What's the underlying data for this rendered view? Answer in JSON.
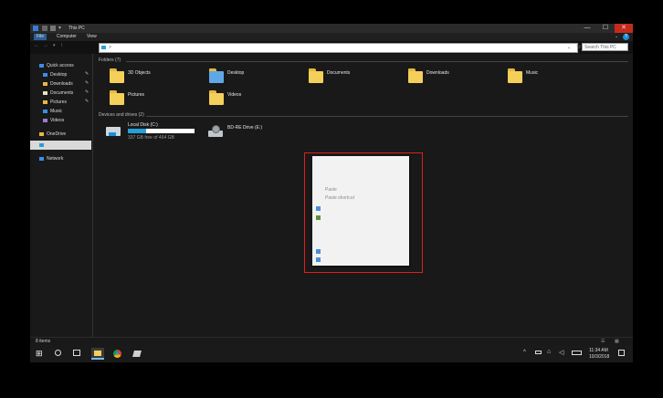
{
  "window": {
    "title": "This PC",
    "controls": {
      "minimize": "—",
      "maximize": "☐",
      "close": "✕"
    }
  },
  "ribbon": {
    "tabs": [
      "File",
      "Computer",
      "View"
    ],
    "help": "?"
  },
  "address": {
    "path_chevron": ">",
    "search_placeholder": "Search This PC"
  },
  "nav": {
    "quick_access": "Quick access",
    "items": [
      "Desktop",
      "Downloads",
      "Documents",
      "Pictures",
      "Music",
      "Videos"
    ],
    "onedrive": "OneDrive",
    "network": "Network"
  },
  "folders": {
    "header": "Folders (7)",
    "items": [
      "3D Objects",
      "Desktop",
      "Documents",
      "Downloads",
      "Music",
      "Pictures",
      "Videos"
    ]
  },
  "drives": {
    "header": "Devices and drives (2)",
    "local_disk": {
      "name": "Local Disk (C:)",
      "free_text": "337 GB free of 464 GB",
      "used_fraction": 0.27
    },
    "bd_drive": {
      "name": "BD-RE Drive (E:)"
    }
  },
  "context_menu": {
    "items": [
      "Paste",
      "Paste shortcut"
    ]
  },
  "status": {
    "count": "8 items"
  },
  "taskbar": {
    "time": "11:34 AM",
    "date": "10/3/2018"
  },
  "colors": {
    "accent": "#1e8fd6",
    "menu_outline": "#e01e1e",
    "folder": "#f4cf5a"
  }
}
